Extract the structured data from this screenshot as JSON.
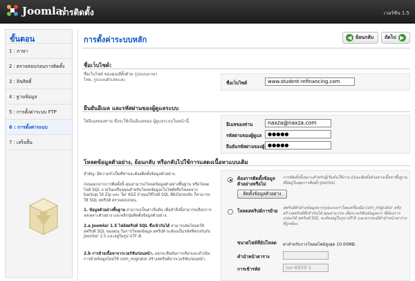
{
  "header": {
    "brand": "Joomla!",
    "title": "การติดตั้ง",
    "version": "เวอร์ชัน 1.5"
  },
  "sidebar": {
    "title": "ขั้นตอน",
    "steps": [
      "1 : ภาษา",
      "2 : ตรวจสอบก่อนการติดตั้ง",
      "3 : ลิขสิทธิ์",
      "4 : ฐานข้อมูล",
      "5 : การตั้งค่าระบบ FTP",
      "6 : การตั้งค่าระบบ",
      "7 : เสร็จสิ้น"
    ]
  },
  "main": {
    "title": "การตั้งค่าระบบหลัก",
    "back_label": "ย้อนกลับ",
    "next_label": "ถัดไป"
  },
  "site": {
    "title": "ชื่อเว็บไซต์:",
    "desc": "ชื่อเว็บไซต์ ของคุณที่ตั้งด้วย รูปแบบภาษาไทย, รูปแบบตัวเลขและ",
    "label": "ชื่อเว็บไซต์",
    "value": "www.student-refinancing.com"
  },
  "admin": {
    "title": "ยืนยันอีเมล และรหัสผ่านของผู้ดูแลระบบ",
    "desc": "ใส่อีเมลของท่าน ซึ่งจะใช้เป็นอีเมลของ ผู้ดูแลระบบในหน้านี้.",
    "email_label": "อีเมลของท่าน",
    "email_value": "naxza@naxza.com",
    "pass_label": "รหัสผ่านของผู้ดูแล",
    "pass_value": "●●●●●",
    "confirm_label": "ยืนยันรหัสผ่านของผู้ดูแล",
    "confirm_value": "●●●●●"
  },
  "sample": {
    "title": "โหลดข้อมูลตัวอย่าง, ย้อนกลับ หรือกลับไปใช้การแสดงเนื้อหาแบบเดิม",
    "p1": "สำคัญ: มีความจำเป็นที่ท่านจะต้องติดตั้งข้อมูลตัวอย่าง.",
    "p2": "ก่อนออกจากการติดตั้งนี้ คุณสามารถโหลดข้อมูลตัวอย่างพื้นฐาน หรือโหลดไฟล์ SQL ภายในเครื่องคุณสำหรับโหลดข้อมูลเว็บไซต์หรือโหลดจาก backup ได้ Zip และ Tar 4GZ ถ้าคุณใช้ไฟล์ SQL ที่ยังไม่รองรับ ก็สามารถใช้ SQL สคริปต์ ตรวจสอบก่อน.",
    "p3_head": "1. ข้อมูลตัวอย่างพื้นฐาน",
    "p3": "สามารถเป็นค่าเริ่มต้น เพื่อทำสิ่งนี้สามารถเลือกการลงเพลาะตัวอย่าง และคลิกปุ่มติดตั้งข้อมูลตัวอย่าง.",
    "p4_head": "2.a Joomla! 1.5 ไฟล์สคริปต์ SQL ซึ่งเข้ากันได้",
    "p4": "สามารถอัพโหลดใช้สคริปต์ SQL ของคุณ ในการโหลดข้อมูล สคริปต์ จะต้องเป็นรหัสที่ตรงกันกับ Joomla! 1.5 และอยู่ในรูป UTF-8.",
    "p5_head": "2.b การย้ายเนื้อหาจากเวอร์ชันก่อนหน้า.",
    "p5": "ออกจะยืนยันการเลือกและดำเนินการย้ายข้อมูลโดยใช้ com_migrator สร้างสคริปต์จากเวอร์ชันก่อนหน้า.",
    "opt1_label": "ต้องการติดตั้งข้อมูลตัวอย่างหรือไม่",
    "opt1_desc": "การติดตั้งนี้เหมาะสำหรับผู้เริ่มต้นใช้งาน มันจะติดตั้งตัวอย่างเนื้อหาพื้นฐานที่มีอยู่ในชุดการติดตั้ง Joomla!.",
    "install_btn": "ติดตั้งข้อมูลตัวอย่าง",
    "opt2_label": "โหลดสคริปต์การย้าย",
    "opt2_desc": "สคริปต์ตัวย้ายข้อมูลจากรูปแบบเก่าโดยเครื่องมือ com_migrator หรือ สร้างสคริปต์ที่เข้ากันได้ คุณสามารถ เลือกเวอร์ชันข้อมูลเก่า ที่ต้องการแปลงได้ สคริปต์ SQL จะต้องอยู่ในรูป utf-8 และควรจะมีคำนำหน้าตารางที่ถูกต้อง.",
    "max_label": "ขนาดไฟล์ที่อัปโหลด",
    "max_value": "ค่าสำหรับการโหลดไฟล์สูงสุด 10.00MB.",
    "prefix_label": "คำนำหน้าตาราง",
    "encoding_label": "การเข้ารหัส",
    "encoding_value": "iso-8859-1"
  }
}
